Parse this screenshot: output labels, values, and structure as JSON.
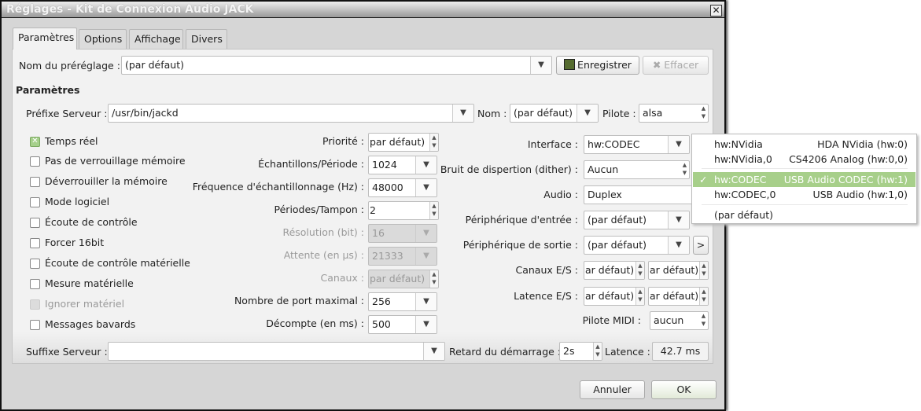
{
  "window": {
    "title": "Réglages - Kit de Connexion Audio JACK",
    "close": "✕"
  },
  "tabs": [
    "Paramètres",
    "Options",
    "Affichage",
    "Divers"
  ],
  "preset": {
    "label": "Nom du préréglage :",
    "value": "(par défaut)",
    "save": "Enregistrer",
    "delete": "Effacer"
  },
  "section_title": "Paramètres",
  "server": {
    "prefix_label": "Préfixe Serveur :",
    "prefix_value": "/usr/bin/jackd",
    "name_label": "Nom :",
    "name_value": "(par défaut)",
    "driver_label": "Pilote :",
    "driver_value": "alsa",
    "suffix_label": "Suffixe Serveur :",
    "suffix_value": ""
  },
  "checkboxes": [
    {
      "label": "Temps réel",
      "checked": true,
      "enabled": true
    },
    {
      "label": "Pas de verrouillage mémoire",
      "checked": false,
      "enabled": true
    },
    {
      "label": "Déverrouiller la mémoire",
      "checked": false,
      "enabled": true
    },
    {
      "label": "Mode logiciel",
      "checked": false,
      "enabled": true
    },
    {
      "label": "Écoute de contrôle",
      "checked": false,
      "enabled": true
    },
    {
      "label": "Forcer 16bit",
      "checked": false,
      "enabled": true
    },
    {
      "label": "Écoute de contrôle matérielle",
      "checked": false,
      "enabled": true
    },
    {
      "label": "Mesure matérielle",
      "checked": false,
      "enabled": true
    },
    {
      "label": "Ignorer matériel",
      "checked": false,
      "enabled": false
    },
    {
      "label": "Messages bavards",
      "checked": false,
      "enabled": true
    }
  ],
  "middle": [
    {
      "label": "Priorité :",
      "value": "par défaut)",
      "kind": "spin",
      "enabled": true
    },
    {
      "label": "Échantillons/Période :",
      "value": "1024",
      "kind": "combo",
      "enabled": true
    },
    {
      "label": "Fréquence d'échantillonnage (Hz) :",
      "value": "48000",
      "kind": "combo",
      "enabled": true
    },
    {
      "label": "Périodes/Tampon :",
      "value": "2",
      "kind": "spin",
      "enabled": true
    },
    {
      "label": "Résolution (bit) :",
      "value": "16",
      "kind": "combo",
      "enabled": false
    },
    {
      "label": "Attente (en µs) :",
      "value": "21333",
      "kind": "combo",
      "enabled": false
    },
    {
      "label": "Canaux :",
      "value": "par défaut)",
      "kind": "spin",
      "enabled": false
    },
    {
      "label": "Nombre de port maximal :",
      "value": "256",
      "kind": "combo",
      "enabled": true
    },
    {
      "label": "Décompte (en ms) :",
      "value": "500",
      "kind": "combo",
      "enabled": true
    }
  ],
  "right": {
    "interface_label": "Interface :",
    "interface_value": "hw:CODEC",
    "dither_label": "Bruit de dispertion (dither) :",
    "dither_value": "Aucun",
    "audio_label": "Audio :",
    "audio_value": "Duplex",
    "input_label": "Périphérique d'entrée :",
    "input_value": "(par défaut)",
    "output_label": "Périphérique de sortie :",
    "output_value": "(par défaut)",
    "output_button": ">",
    "channels_label": "Canaux E/S :",
    "channels_in": "ar défaut)",
    "channels_out": "ar défaut)",
    "latency_label": "Latence E/S :",
    "latency_in": "ar défaut)",
    "latency_out": "ar défaut)",
    "midi_label": "Pilote MIDI :",
    "midi_value": "aucun"
  },
  "bottom": {
    "start_delay_label": "Retard du démarrage :",
    "start_delay_value": "2s",
    "latency_label": "Latence :",
    "latency_value": "42.7 ms"
  },
  "popup": [
    {
      "name": "hw:NVidia",
      "desc": "HDA NVidia (hw:0)",
      "selected": false
    },
    {
      "name": "hw:NVidia,0",
      "desc": "CS4206 Analog (hw:0,0)",
      "selected": false
    },
    {
      "name": "hw:CODEC",
      "desc": "USB Audio CODEC (hw:1)",
      "selected": true,
      "check": "✓"
    },
    {
      "name": "hw:CODEC,0",
      "desc": "USB Audio (hw:1,0)",
      "selected": false
    },
    {
      "name": "(par défaut)",
      "desc": "",
      "selected": false
    }
  ],
  "footer": {
    "cancel": "Annuler",
    "ok": "OK"
  }
}
